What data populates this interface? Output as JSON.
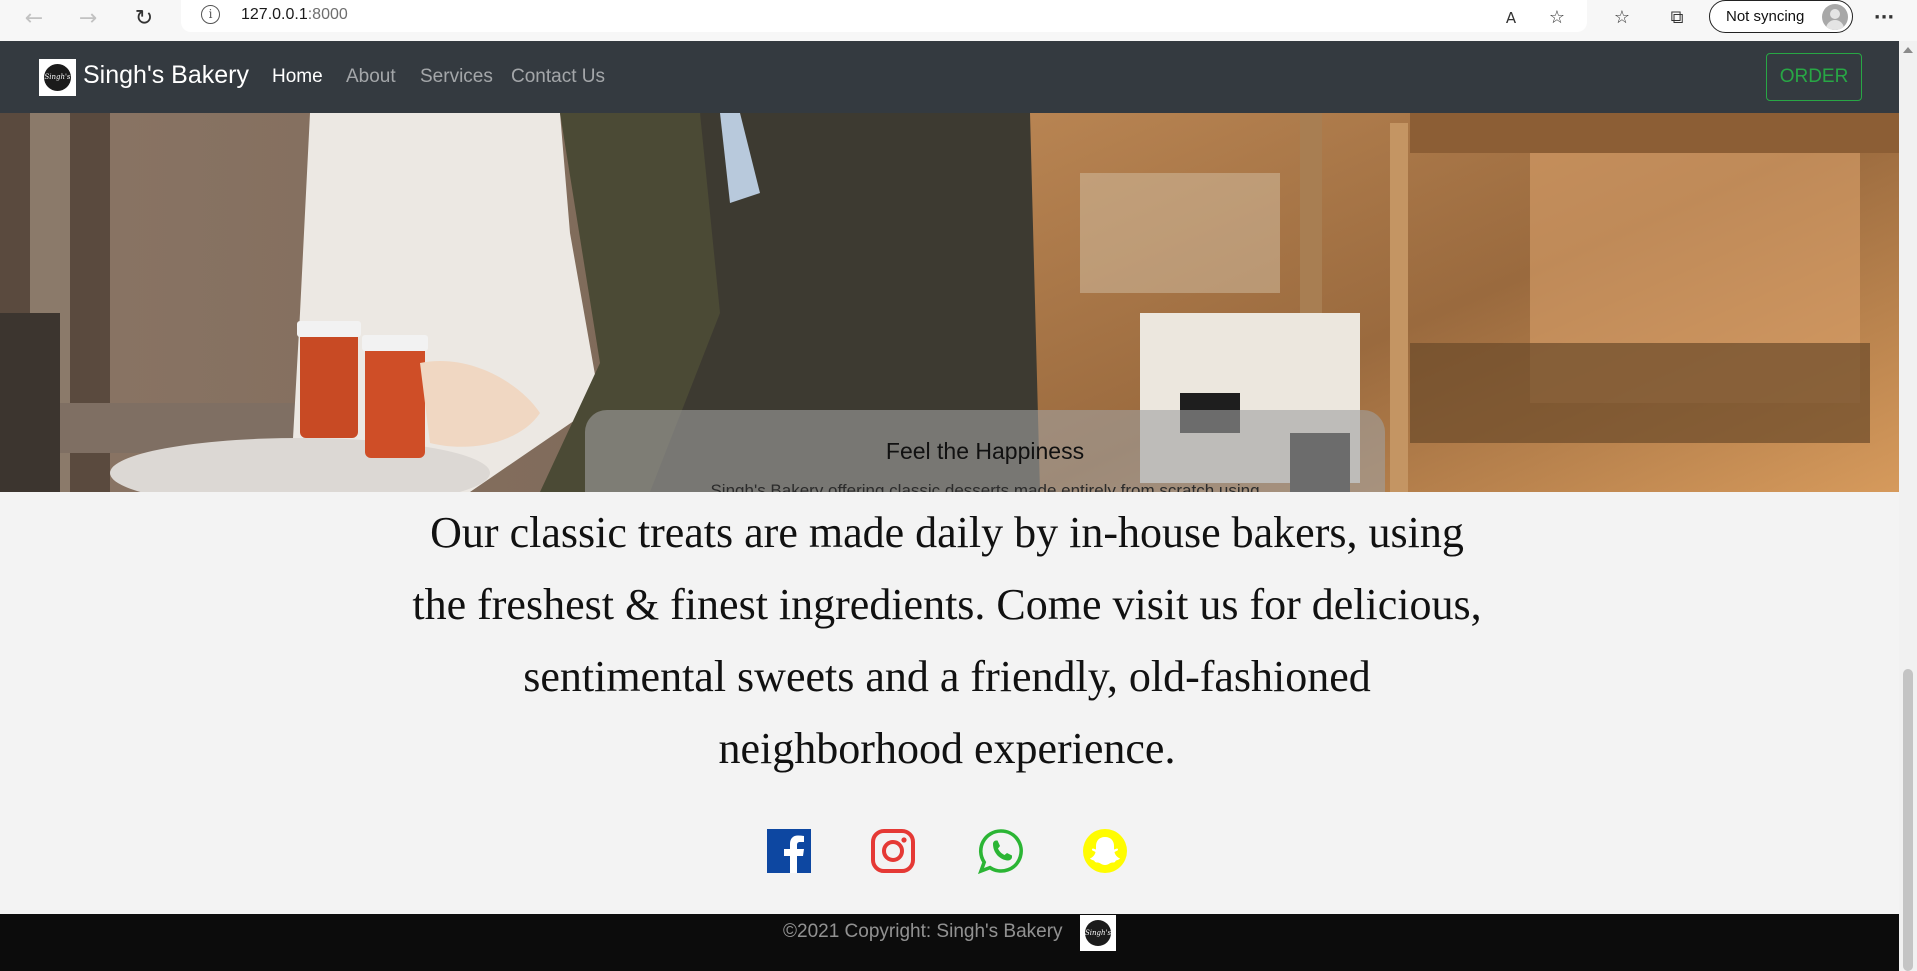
{
  "browser": {
    "url_host": "127.0.0.1",
    "url_port": ":8000",
    "profile_label": "Not syncing",
    "back_icon": "←",
    "forward_icon": "→",
    "reload_icon": "↻",
    "info_icon": "i",
    "read_aloud_icon": "A",
    "add_favorite_icon": "☆",
    "favorites_icon": "☆",
    "collections_icon": "⧉",
    "more_icon": "···"
  },
  "navbar": {
    "brand_logo_text": "Singh's",
    "brand": "Singh's Bakery",
    "links": [
      "Home",
      "About",
      "Services",
      "Contact Us"
    ],
    "active_index": 0,
    "order_label": "ORDER"
  },
  "hero": {
    "caption_title": "Feel the Happiness",
    "caption_text": "Singh's Bakery offering classic desserts made entirely from scratch using simple, natural ingredients."
  },
  "intro_text": "Our classic treats are made daily by in-house bakers, using the freshest & finest ingredients. Come visit us for delicious, sentimental sweets and a friendly, old-fashioned neighborhood experience.",
  "social": [
    {
      "name": "facebook",
      "color": "#0d47a1"
    },
    {
      "name": "instagram",
      "color": "#e53935"
    },
    {
      "name": "whatsapp",
      "color": "#2bb534"
    },
    {
      "name": "snapchat",
      "color": "#fffc00"
    }
  ],
  "footer": {
    "copyright": "©2021 Copyright: Singh's Bakery",
    "logo_text": "Singh's"
  },
  "colors": {
    "navbar_bg": "#343a40",
    "order_green": "#28a745",
    "footer_bg": "#0c0c0c",
    "page_bg": "#f3f3f3"
  }
}
